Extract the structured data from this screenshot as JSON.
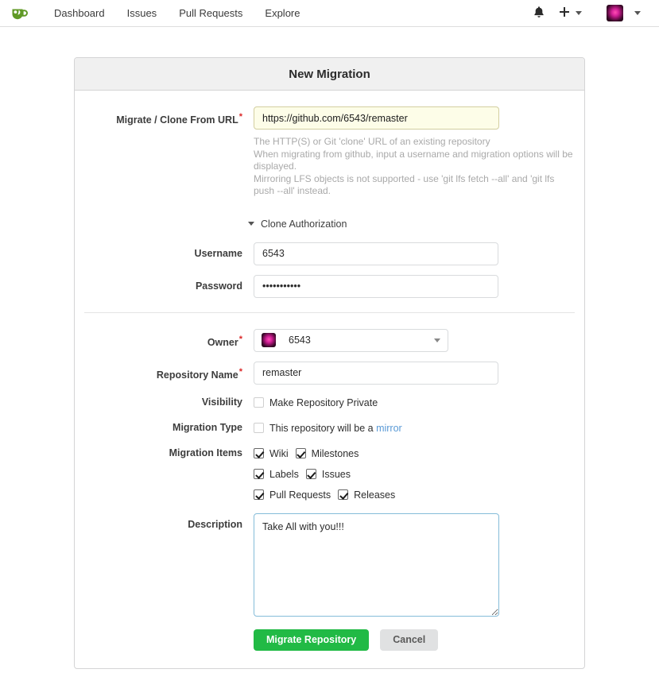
{
  "navbar": {
    "logo_icon": "gitea-teacup-logo-icon",
    "links": [
      {
        "label": "Dashboard"
      },
      {
        "label": "Issues"
      },
      {
        "label": "Pull Requests"
      },
      {
        "label": "Explore"
      }
    ],
    "right": {
      "notification_icon": "bell-icon",
      "create_icon": "plus-icon",
      "create_caret_icon": "chevron-down-icon",
      "avatar_icon": "user-avatar",
      "avatar_caret_icon": "chevron-down-icon"
    }
  },
  "card": {
    "title": "New Migration"
  },
  "form": {
    "url": {
      "label": "Migrate / Clone From URL",
      "required_marker": "*",
      "value": "https://github.com/6543/remaster",
      "placeholder": "",
      "help_line1": "The HTTP(S) or Git 'clone' URL of an existing repository",
      "help_line2": "When migrating from github, input a username and migration options will be displayed.",
      "help_line3": "Mirroring LFS objects is not supported - use 'git lfs fetch --all' and 'git lfs push --all' instead."
    },
    "clone_authorization": {
      "toggle_label": "Clone Authorization",
      "caret_icon": "triangle-down-icon"
    },
    "username": {
      "label": "Username",
      "value": "6543",
      "placeholder": ""
    },
    "password": {
      "label": "Password",
      "value": "•••••••••••",
      "placeholder": ""
    },
    "owner": {
      "label": "Owner",
      "required_marker": "*",
      "value": "6543",
      "caret_icon": "chevron-down-icon",
      "avatar_icon": "owner-avatar"
    },
    "repository_name": {
      "label": "Repository Name",
      "required_marker": "*",
      "value": "remaster",
      "placeholder": ""
    },
    "visibility": {
      "label": "Visibility",
      "checkbox_label": "Make Repository Private",
      "checked": false
    },
    "migration_type": {
      "label": "Migration Type",
      "checkbox_label_prefix": "This repository will be a ",
      "checkbox_link_label": "mirror",
      "checked": false
    },
    "migration_items": {
      "label": "Migration Items",
      "rows": [
        [
          {
            "label": "Wiki",
            "checked": true
          },
          {
            "label": "Milestones",
            "checked": true
          }
        ],
        [
          {
            "label": "Labels",
            "checked": true
          },
          {
            "label": "Issues",
            "checked": true
          }
        ],
        [
          {
            "label": "Pull Requests",
            "checked": true
          },
          {
            "label": "Releases",
            "checked": true
          }
        ]
      ]
    },
    "description": {
      "label": "Description",
      "value": "Take All with you!!!",
      "placeholder": ""
    },
    "actions": {
      "submit_label": "Migrate Repository",
      "cancel_label": "Cancel"
    }
  },
  "colors": {
    "brand_green": "#21ba45",
    "link_blue": "#5a9ad6",
    "required_red": "#db2828",
    "header_gray": "#f0f0f0",
    "autofill_yellow": "#fdfde8",
    "focus_blue": "#85bcd9"
  }
}
